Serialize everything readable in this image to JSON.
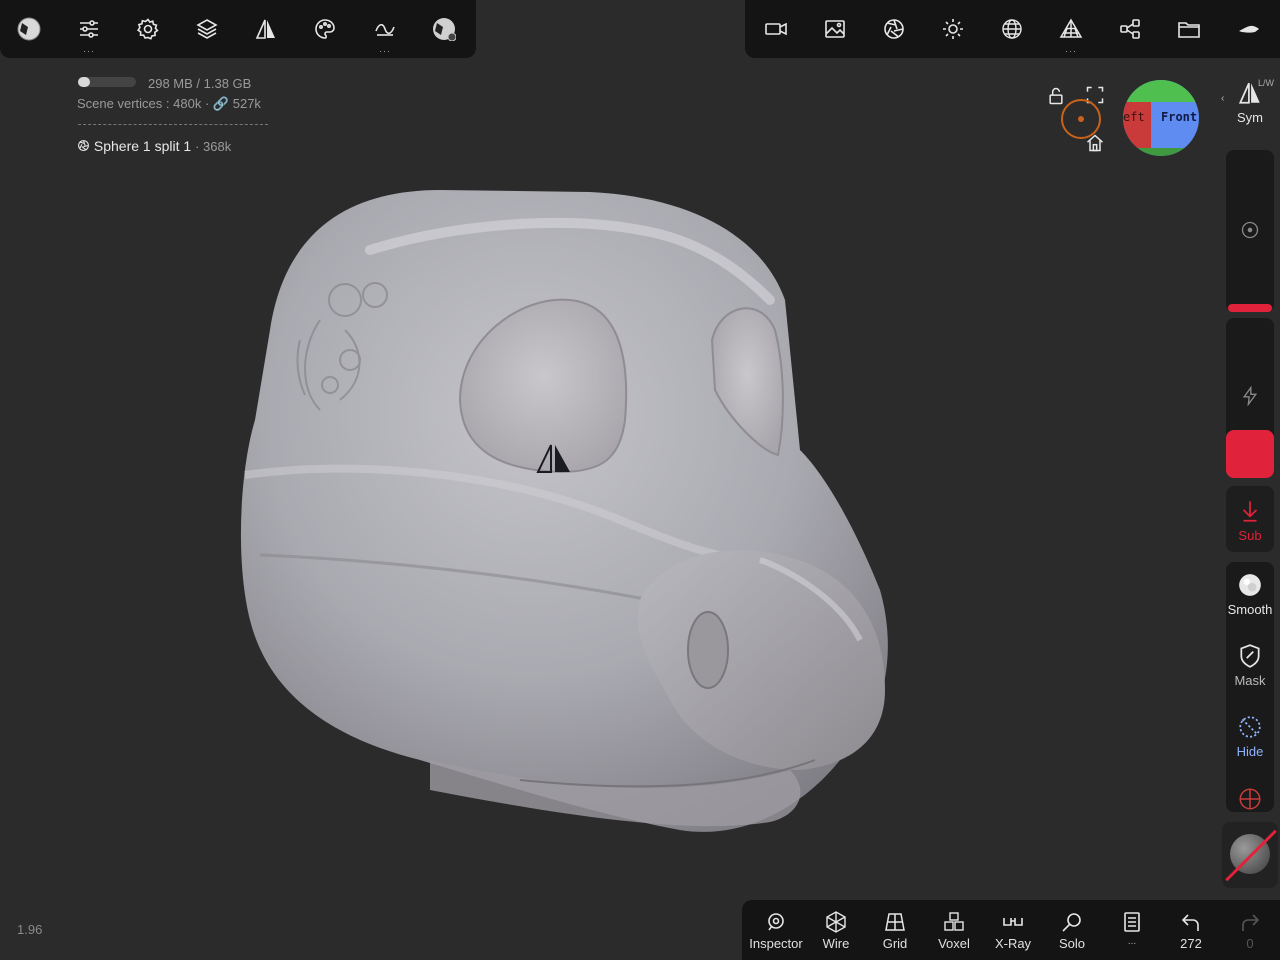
{
  "info": {
    "memory": "298 MB / 1.38 GB",
    "memory_fraction": 0.21,
    "scene_vertices_label": "Scene vertices :",
    "scene_vertices": "480k",
    "linked_vertices": "527k",
    "object_name": "Sphere 1 split 1",
    "object_vertices": "· 368k"
  },
  "gizmo": {
    "left_label": "eft",
    "front_label": "Front"
  },
  "right_panel": {
    "sym_label": "Sym",
    "sym_badge": "L/W",
    "sub_label": "Sub",
    "smooth_label": "Smooth",
    "mask_label": "Mask",
    "hide_label": "Hide",
    "radius_level": 0.02,
    "intensity_level": 0.0
  },
  "bottom_bar": {
    "inspector": "Inspector",
    "wire": "Wire",
    "grid": "Grid",
    "voxel": "Voxel",
    "xray": "X-Ray",
    "solo": "Solo",
    "more": "...",
    "undo_count": "272",
    "redo_count": "0"
  },
  "fps": "1.96",
  "colors": {
    "accent_red": "#e0223a",
    "gizmo_green": "#4fbf4f",
    "gizmo_blue": "#5f8cf0",
    "gizmo_red": "#c93b3b",
    "orange_marker": "#c8621a"
  },
  "icons": {
    "top_left": [
      "app-icon",
      "sliders-icon",
      "gear-icon",
      "layers-icon",
      "symmetry-icon",
      "palette-icon",
      "curve-icon",
      "material-icon"
    ],
    "top_right": [
      "camera-icon",
      "image-icon",
      "aperture-icon",
      "sun-icon",
      "sphere-grid-icon",
      "pyramid-icon",
      "share-icon",
      "folder-icon",
      "hat-icon"
    ]
  }
}
